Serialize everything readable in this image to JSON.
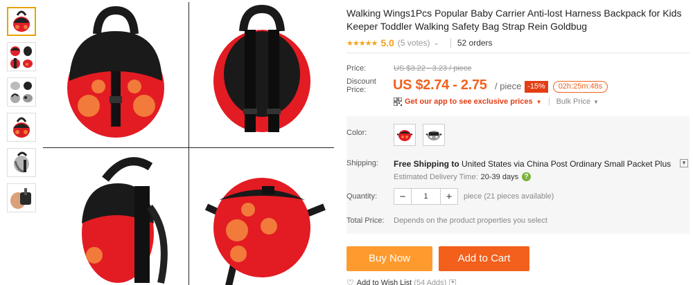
{
  "thumbnails": [
    {
      "icon": "ladybug-front-thumb"
    },
    {
      "icon": "ladybug-multi-thumb"
    },
    {
      "icon": "grey-pack-thumb"
    },
    {
      "icon": "ladybug-side-thumb"
    },
    {
      "icon": "grey-side-thumb"
    },
    {
      "icon": "hand-pack-thumb"
    }
  ],
  "product": {
    "title": "Walking Wings1Pcs Popular Baby Carrier Anti-lost Harness Backpack for Kids Keeper Toddler Walking Safety Bag Strap Rein Goldbug",
    "stars": "★★★★★",
    "score": "5.0",
    "votes": "(5 votes)",
    "orders": "52 orders"
  },
  "price": {
    "label": "Price:",
    "original": "US $3.22 - 3.23 / piece",
    "discount_label_1": "Discount",
    "discount_label_2": "Price:",
    "discounted": "US $2.74 - 2.75",
    "unit": "/ piece",
    "discount_pct": "-15%",
    "countdown": "02h:25m:48s",
    "app_link": "Get our app to see exclusive prices",
    "bulk": "Bulk Price"
  },
  "color": {
    "label": "Color:",
    "options": [
      "red-ladybug",
      "grey-elephant"
    ]
  },
  "shipping": {
    "label": "Shipping:",
    "free": "Free Shipping to",
    "details": "United States via China Post Ordinary Small Packet Plus",
    "edt_label": "Estimated Delivery Time:",
    "edt_value": "20-39 days"
  },
  "quantity": {
    "label": "Quantity:",
    "value": "1",
    "note": "piece (21 pieces available)"
  },
  "total": {
    "label": "Total Price:",
    "note": "Depends on the product properties you select"
  },
  "actions": {
    "buy_now": "Buy Now",
    "add_to_cart": "Add to Cart",
    "wishlist": "Add to Wish List",
    "wish_count": "(54 Adds)"
  },
  "colors": {
    "orange": "#f2601c",
    "buy": "#ff9a2e",
    "star": "#f7a21b",
    "red": "#e33d14"
  }
}
